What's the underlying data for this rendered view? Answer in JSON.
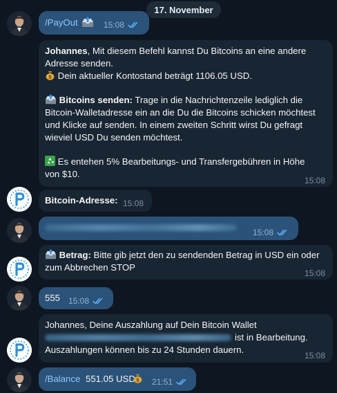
{
  "date_separator": "17. November",
  "messages": {
    "m1": {
      "command": "/PayOut",
      "time": "15:08"
    },
    "m2": {
      "name": "Johannes",
      "line1": ", Mit diesem Befehl kannst Du Bitcoins an eine andere Adresse senden.",
      "line2": "Dein aktueller Kontostand beträgt 1106.05 USD.",
      "section_title": "Bitcoins senden:",
      "section_body": " Trage in die Nachrichtenzeile lediglich die Bitcoin-Walletadresse ein an die Du die Bitcoins schicken möchtest und Klicke auf senden. In einem zweiten Schritt wirst Du gefragt wieviel USD Du senden möchtest.",
      "fee_note": "Es entehen 5% Bearbeitungs- und Transfergebühren in Höhe von $10.",
      "time": "15:08"
    },
    "m3": {
      "text": "Bitcoin-Adresse:",
      "time": "15:08"
    },
    "m4": {
      "time": "15:08"
    },
    "m5": {
      "title": "Betrag:",
      "body": " Bitte gib jetzt den zu sendenden Betrag in USD ein oder zum Abbrechen  STOP",
      "time": "15:08"
    },
    "m6": {
      "text": "555",
      "time": "15:08"
    },
    "m7": {
      "line1": "Johannes, Deine Auszahlung auf Dein Bitcoin Wallet",
      "line2_suffix": "ist in Bearbeitung.",
      "line3": "Auszahlungen können bis zu 24 Stunden dauern.",
      "time": "15:08"
    },
    "m8": {
      "command": "/Balance",
      "amount": "551.05 USD",
      "time": "21:51"
    }
  },
  "icons": {
    "outbox": "outbox-tray-icon",
    "money_bag": "money-bag-icon",
    "recycle": "recycle-icon",
    "read_checks": "double-check-icon",
    "bot_logo": "bot-logo-icon",
    "user_photo": "user-avatar-icon"
  },
  "colors": {
    "background": "#0e1621",
    "outgoing_bubble": "#2b5278",
    "incoming_bubble": "#182533",
    "command_link": "#8fc8ff",
    "timestamp": "#7d8e9f"
  }
}
